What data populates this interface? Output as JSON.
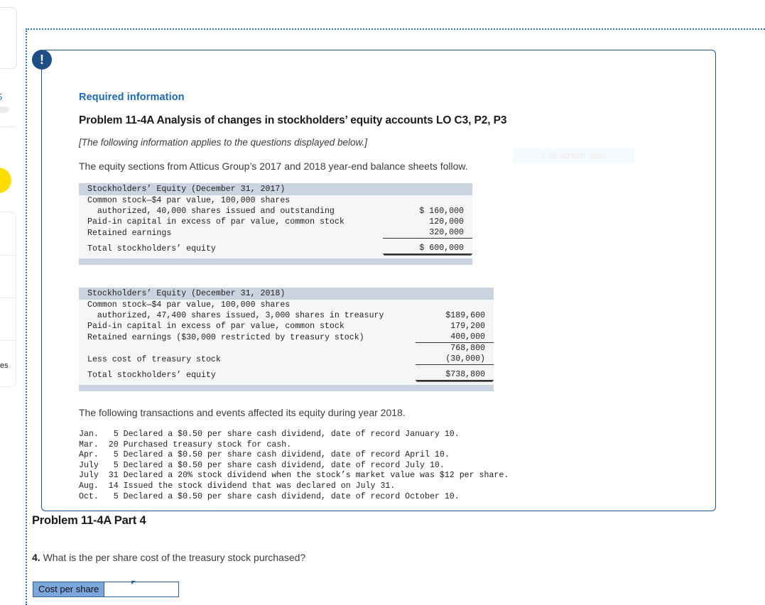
{
  "snip": {
    "watermark": "Full-screen Snip"
  },
  "background": {
    "partial_number": "5",
    "partial_text": "es"
  },
  "callout": {
    "icon": "exclamation-icon",
    "icon_glyph": "!",
    "required_label": "Required information",
    "problem_title": "Problem 11-4A Analysis of changes in stockholders’ equity accounts LO C3, P2, P3",
    "applies_note": "[The following information applies to the questions displayed below.]",
    "intro": "The equity sections from Atticus Group’s 2017 and 2018 year-end balance sheets follow.",
    "transactions_intro": "The following transactions and events affected its equity during year 2018."
  },
  "table_2017": {
    "header": "Stockholders’ Equity (December 31, 2017)",
    "rows": [
      {
        "label": "Common stock—$4 par value, 100,000 shares",
        "value": ""
      },
      {
        "label": "  authorized, 40,000 shares issued and outstanding",
        "value": "$ 160,000"
      },
      {
        "label": "Paid-in capital in excess of par value, common stock",
        "value": "120,000"
      },
      {
        "label": "Retained earnings",
        "value": "320,000"
      },
      {
        "label": "Total stockholders’ equity",
        "value": "$ 600,000"
      }
    ]
  },
  "table_2018": {
    "header": "Stockholders’ Equity (December 31, 2018)",
    "rows": [
      {
        "label": "Common stock—$4 par value, 100,000 shares",
        "value": ""
      },
      {
        "label": "  authorized, 47,400 shares issued, 3,000 shares in treasury",
        "value": "$189,600"
      },
      {
        "label": "Paid-in capital in excess of par value, common stock",
        "value": "179,200"
      },
      {
        "label": "Retained earnings ($30,000 restricted by treasury stock)",
        "value": "400,000"
      },
      {
        "label": "",
        "value": "768,800"
      },
      {
        "label": "Less cost of treasury stock",
        "value": "(30,000)"
      },
      {
        "label": "Total stockholders’ equity",
        "value": "$738,800"
      }
    ]
  },
  "transactions": [
    "Jan.   5 Declared a $0.50 per share cash dividend, date of record January 10.",
    "Mar.  20 Purchased treasury stock for cash.",
    "Apr.   5 Declared a $0.50 per share cash dividend, date of record April 10.",
    "July   5 Declared a $0.50 per share cash dividend, date of record July 10.",
    "July  31 Declared a 20% stock dividend when the stock’s market value was $12 per share.",
    "Aug.  14 Issued the stock dividend that was declared on July 31.",
    "Oct.   5 Declared a $0.50 per share cash dividend, date of record October 10."
  ],
  "part4": {
    "title": "Problem 11-4A Part 4",
    "question_number": "4.",
    "question_text": " What is the per share cost of the treasury stock purchased?",
    "answer_label": "Cost per share",
    "answer_value": "",
    "answer_placeholder": ""
  },
  "colors": {
    "accent_blue": "#1f69b3",
    "border_blue": "#20558f",
    "badge_navy": "#1f4e85",
    "table_header": "#ccd3e0",
    "table_body": "#f5f6f8",
    "input_label": "#7ba7dd",
    "snip_dotted": "#2f6fb5",
    "yellow_circle": "#ffdd00"
  }
}
